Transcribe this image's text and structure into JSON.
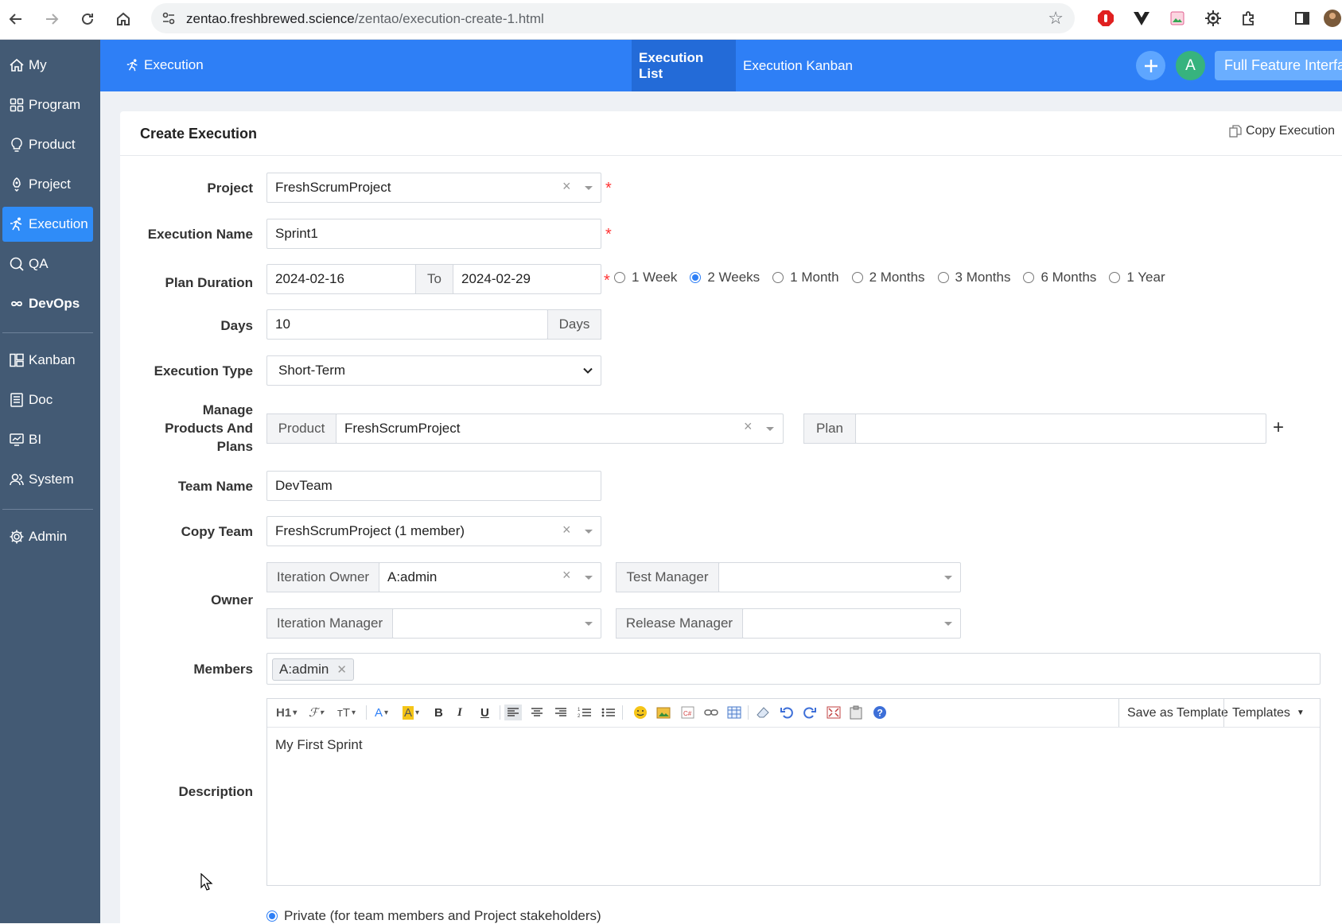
{
  "browser": {
    "url_host": "zentao.freshbrewed.science",
    "url_path": "/zentao/execution-create-1.html"
  },
  "sidebar": {
    "items": [
      {
        "label": "My",
        "icon": "home-icon"
      },
      {
        "label": "Program",
        "icon": "grid-icon"
      },
      {
        "label": "Product",
        "icon": "lightbulb-icon"
      },
      {
        "label": "Project",
        "icon": "rocket-icon"
      },
      {
        "label": "Execution",
        "icon": "runner-icon",
        "active": true
      },
      {
        "label": "QA",
        "icon": "magnifier-icon"
      },
      {
        "label": "DevOps",
        "icon": "infinity-icon"
      },
      {
        "label": "Kanban",
        "icon": "kanban-icon"
      },
      {
        "label": "Doc",
        "icon": "doc-icon"
      },
      {
        "label": "BI",
        "icon": "monitor-icon"
      },
      {
        "label": "System",
        "icon": "users-icon"
      },
      {
        "label": "Admin",
        "icon": "gear-icon"
      }
    ]
  },
  "header": {
    "crumb": "Execution",
    "tabs": [
      "Execution List",
      "Execution Kanban"
    ],
    "avatar_letter": "A",
    "full_feature": "Full Feature Interface"
  },
  "form": {
    "title": "Create Execution",
    "copy_execution": "Copy Execution",
    "project_label": "Project",
    "project_value": "FreshScrumProject",
    "name_label": "Execution Name",
    "name_value": "Sprint1",
    "plan_label": "Plan Duration",
    "start_date": "2024-02-16",
    "to_label": "To",
    "end_date": "2024-02-29",
    "durations": [
      "1 Week",
      "2 Weeks",
      "1 Month",
      "2 Months",
      "3 Months",
      "6 Months",
      "1 Year"
    ],
    "selected_duration": "2 Weeks",
    "days_label": "Days",
    "days_value": "10",
    "days_unit": "Days",
    "type_label": "Execution Type",
    "type_value": "Short-Term",
    "mpp_label_1": "Manage",
    "mpp_label_2": "Products And",
    "mpp_label_3": "Plans",
    "product_addon": "Product",
    "product_value": "FreshScrumProject",
    "plan_addon": "Plan",
    "plan_value": "",
    "team_label": "Team Name",
    "team_value": "DevTeam",
    "copy_team_label": "Copy Team",
    "copy_team_value": "FreshScrumProject (1 member)",
    "owner_label": "Owner",
    "iteration_owner": "Iteration Owner",
    "iteration_owner_value": "A:admin",
    "test_manager": "Test Manager",
    "test_manager_value": "",
    "iteration_manager": "Iteration Manager",
    "iteration_manager_value": "",
    "release_manager": "Release Manager",
    "release_manager_value": "",
    "members_label": "Members",
    "member_chip": "A:admin",
    "description_label": "Description",
    "description_value": "My First Sprint",
    "save_template": "Save as Template",
    "templates": "Templates",
    "private_label": "Private (for team members and Project stakeholders)"
  },
  "colors": {
    "brand_blue": "#2e7ff6",
    "sidebar_bg": "#435a74",
    "required": "#ff3333"
  }
}
